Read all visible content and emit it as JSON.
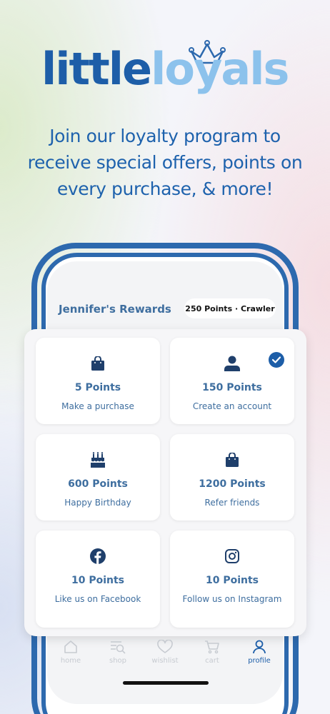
{
  "logo": {
    "part1": "little",
    "part2": "loyals"
  },
  "tagline": "Join our loyalty program to receive special offers, points on every purchase, & more!",
  "rewards": {
    "title": "Jennifer's Rewards",
    "points_badge": "250 Points · Crawler"
  },
  "tiles": [
    {
      "points": "5 Points",
      "label": "Make a purchase",
      "icon": "shopping-bag-icon",
      "completed": false
    },
    {
      "points": "150 Points",
      "label": "Create an account",
      "icon": "user-icon",
      "completed": true
    },
    {
      "points": "600 Points",
      "label": "Happy Birthday",
      "icon": "birthday-cake-icon",
      "completed": false
    },
    {
      "points": "1200 Points",
      "label": "Refer friends",
      "icon": "shopping-bag-icon",
      "completed": false
    },
    {
      "points": "10 Points",
      "label": "Like us on Facebook",
      "icon": "facebook-icon",
      "completed": false
    },
    {
      "points": "10 Points",
      "label": "Follow us on Instagram",
      "icon": "instagram-icon",
      "completed": false
    }
  ],
  "tabbar": {
    "tabs": [
      {
        "label": "home",
        "icon": "home-icon",
        "active": false
      },
      {
        "label": "shop",
        "icon": "shop-search-icon",
        "active": false
      },
      {
        "label": "wishlist",
        "icon": "heart-icon",
        "active": false
      },
      {
        "label": "cart",
        "icon": "cart-icon",
        "active": false
      },
      {
        "label": "profile",
        "icon": "profile-icon",
        "active": true
      }
    ]
  },
  "colors": {
    "brand_dark": "#1d5ea8",
    "brand_light": "#8cc2ec",
    "text_blue": "#3e6e9f",
    "phone_frame": "#2d69ae"
  }
}
